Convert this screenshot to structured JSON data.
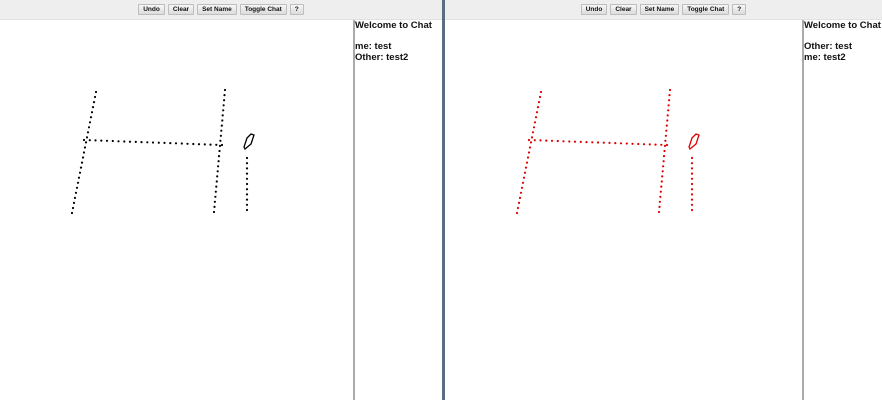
{
  "toolbar": {
    "undo_label": "Undo",
    "clear_label": "Clear",
    "set_name_label": "Set Name",
    "toggle_chat_label": "Toggle Chat",
    "help_label": "?"
  },
  "colors": {
    "divider": "#5a6e80",
    "left_ink": "#000000",
    "right_ink": "#e00000"
  },
  "left_panel": {
    "chat": {
      "title": "Welcome to Chat",
      "messages": [
        {
          "text": "me: test"
        },
        {
          "text": "Other: test2"
        }
      ]
    }
  },
  "right_panel": {
    "chat": {
      "title": "Welcome to Chat",
      "messages": [
        {
          "text": "Other: test"
        },
        {
          "text": "me: test2"
        }
      ]
    }
  }
}
